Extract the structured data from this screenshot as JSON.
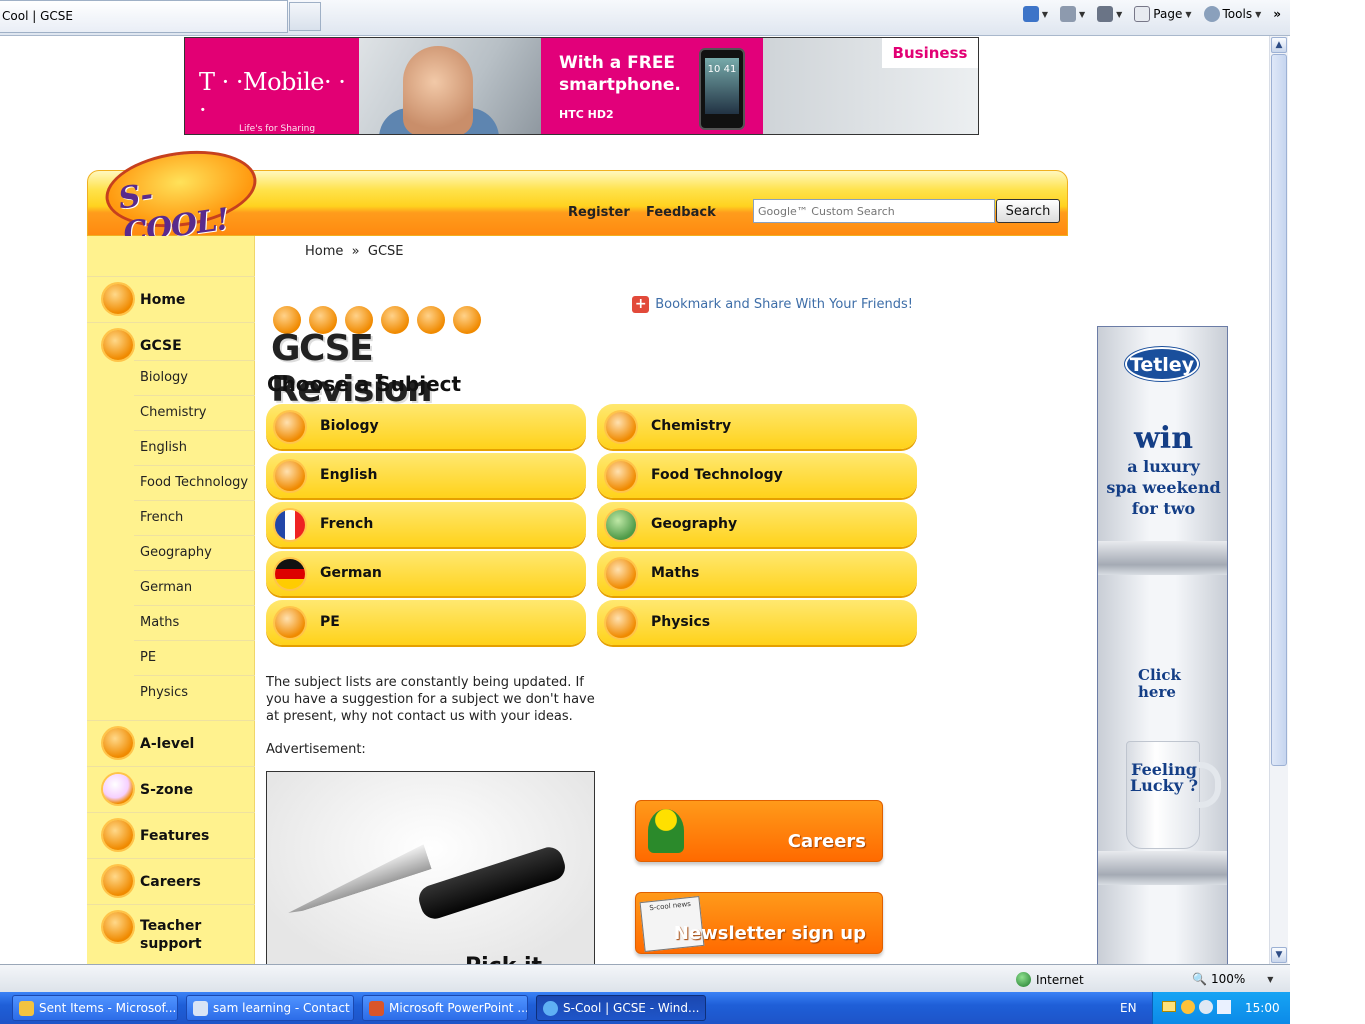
{
  "browser": {
    "tab_title": "Cool | GCSE",
    "commands": [
      {
        "label": "",
        "icon": "home-icon"
      },
      {
        "label": "",
        "icon": "rss-icon"
      },
      {
        "label": "",
        "icon": "print-icon"
      },
      {
        "label": "Page",
        "icon": "page-icon"
      },
      {
        "label": "Tools",
        "icon": "tools-icon"
      }
    ],
    "overflow": "»"
  },
  "banner_ad": {
    "brand": "T · ·Mobile· · ·",
    "slogan": "Life's for Sharing",
    "offer_line1": "With a FREE",
    "offer_line2": "smartphone.",
    "model": "HTC HD2",
    "phone_time": "10 41",
    "tag": "Business"
  },
  "header": {
    "logo": "S-COOL!",
    "register": "Register",
    "feedback": "Feedback",
    "search_placeholder": "Google™ Custom Search",
    "search_button": "Search"
  },
  "sidebar": {
    "main": [
      {
        "label": "Home",
        "icon": "home-icon"
      },
      {
        "label": "GCSE",
        "icon": "gcse-icon"
      },
      {
        "label": "A-level",
        "icon": "alevel-icon"
      },
      {
        "label": "S-zone",
        "icon": "szone-icon"
      },
      {
        "label": "Features",
        "icon": "features-icon"
      },
      {
        "label": "Careers",
        "icon": "careers-icon"
      },
      {
        "label": "Teacher\nsupport",
        "icon": "teacher-icon"
      }
    ],
    "gcse_subjects": [
      "Biology",
      "Chemistry",
      "English",
      "Food Technology",
      "French",
      "Geography",
      "German",
      "Maths",
      "PE",
      "Physics"
    ]
  },
  "content": {
    "breadcrumb": "Home  »  GCSE",
    "bookmark": "Bookmark and Share With Your Friends!",
    "revision_title": "GCSE Revision",
    "choose_subject": "Choose a Subject",
    "subjects": [
      "Biology",
      "Chemistry",
      "English",
      "Food Technology",
      "French",
      "Geography",
      "German",
      "Maths",
      "PE",
      "Physics"
    ],
    "note": "The subject lists are constantly being updated. If you have a suggestion for a subject we don't have at present, why not contact us with your ideas.",
    "ad_label": "Advertisement:",
    "ad_caption": "Pick it",
    "promos": {
      "careers": "Careers",
      "newsletter": "Newsletter sign up",
      "newsletter_paper": "S-cool news"
    }
  },
  "tetley_ad": {
    "brand": "Tetley",
    "win": "win",
    "line1": "a luxury",
    "line2": "spa weekend",
    "line3": "for two",
    "click": "Click here",
    "mug_text": "Feeling Lucky ?"
  },
  "status_bar": {
    "zone": "Internet",
    "zoom": "100%"
  },
  "taskbar": {
    "tasks": [
      "Sent Items - Microsof...",
      "sam learning - Contact",
      "Microsoft PowerPoint ...",
      "S-Cool | GCSE - Wind..."
    ],
    "language": "EN",
    "clock": "15:00"
  },
  "colors": {
    "accent_orange": "#ff8a10",
    "sidebar_yellow": "#fff28e",
    "subject_yellow": "#ffd21a",
    "tmobile_magenta": "#e20074",
    "tetley_blue": "#1a4f9c",
    "link_blue": "#3e6ea8"
  }
}
